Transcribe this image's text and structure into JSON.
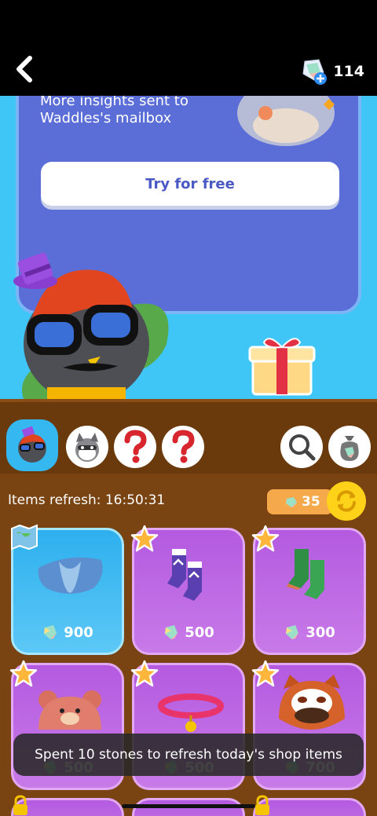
{
  "header": {
    "back_icon": "chevron-left-icon",
    "currency_icon": "gem-plus-icon",
    "currency_amount": "114"
  },
  "promo": {
    "text": "More insights sent to Waddles's mailbox",
    "button_label": "Try for free"
  },
  "tabs": [
    {
      "name": "tab-bird",
      "icon": "bird-avatar-icon",
      "active": true
    },
    {
      "name": "tab-raccoon",
      "icon": "raccoon-avatar-icon"
    },
    {
      "name": "tab-unknown-1",
      "icon": "question-icon"
    },
    {
      "name": "tab-unknown-2",
      "icon": "question-icon"
    },
    {
      "name": "tab-search",
      "icon": "search-icon"
    },
    {
      "name": "tab-bag",
      "icon": "gem-bag-icon"
    }
  ],
  "shop": {
    "refresh_label": "Items refresh: 16:50:31",
    "refresh_cost": "35"
  },
  "items": [
    {
      "name": "blue-cape",
      "price": "900",
      "badge": "map-icon"
    },
    {
      "name": "snowflake-socks",
      "price": "500",
      "badge": "star-icon"
    },
    {
      "name": "green-socks",
      "price": "300",
      "badge": "star-icon"
    },
    {
      "name": "bear-hat",
      "price": "500",
      "badge": "star-icon"
    },
    {
      "name": "pink-collar",
      "price": "500",
      "badge": "star-icon"
    },
    {
      "name": "red-panda-hood",
      "price": "700",
      "badge": "star-icon"
    }
  ],
  "toast": {
    "text": "Spent 10 stones to refresh today's shop items"
  },
  "colors": {
    "sky": "#3fc6f7",
    "shelf": "#6b3a0c",
    "card_purple": "#b45ae0",
    "card_blue": "#2eb0ee",
    "accent_yellow": "#ffd21a"
  }
}
